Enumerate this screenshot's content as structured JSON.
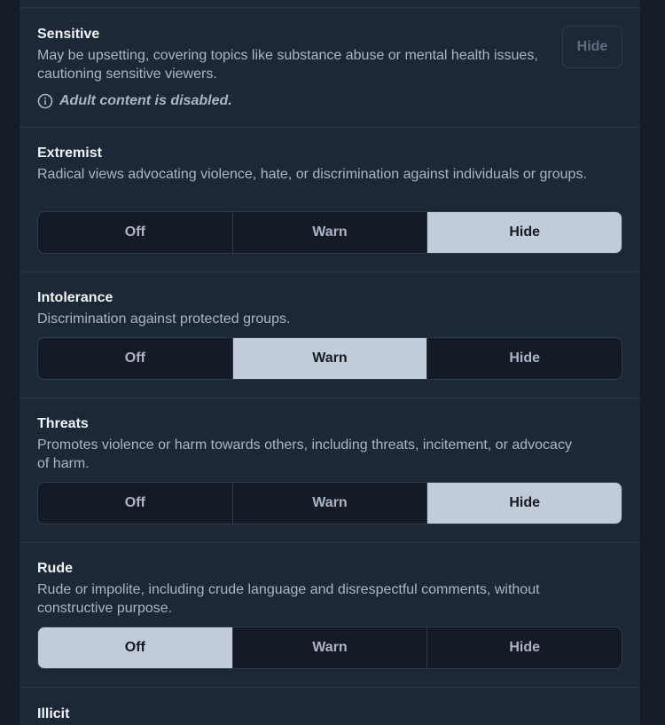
{
  "sections": [
    {
      "title": "Sensitive",
      "description": "May be upsetting, covering topics like substance abuse or mental health issues, cautioning sensitive viewers.",
      "note": "Adult content is disabled.",
      "disabled_button": "Hide"
    },
    {
      "title": "Extremist",
      "description": "Radical views advocating violence, hate, or discrimination against individuals or groups.",
      "options": [
        "Off",
        "Warn",
        "Hide"
      ],
      "selected": "Hide"
    },
    {
      "title": "Intolerance",
      "description": "Discrimination against protected groups.",
      "options": [
        "Off",
        "Warn",
        "Hide"
      ],
      "selected": "Warn"
    },
    {
      "title": "Threats",
      "description": "Promotes violence or harm towards others, including threats, incitement, or advocacy of harm.",
      "options": [
        "Off",
        "Warn",
        "Hide"
      ],
      "selected": "Hide"
    },
    {
      "title": "Rude",
      "description": "Rude or impolite, including crude language and disrespectful comments, without constructive purpose.",
      "options": [
        "Off",
        "Warn",
        "Hide"
      ],
      "selected": "Off"
    },
    {
      "title": "Illicit"
    }
  ],
  "colors": {
    "background": "#151d28",
    "panel": "#1d2837",
    "selected": "#c2cbd8",
    "text": "#f1f4f8",
    "muted": "#aab6c5"
  }
}
